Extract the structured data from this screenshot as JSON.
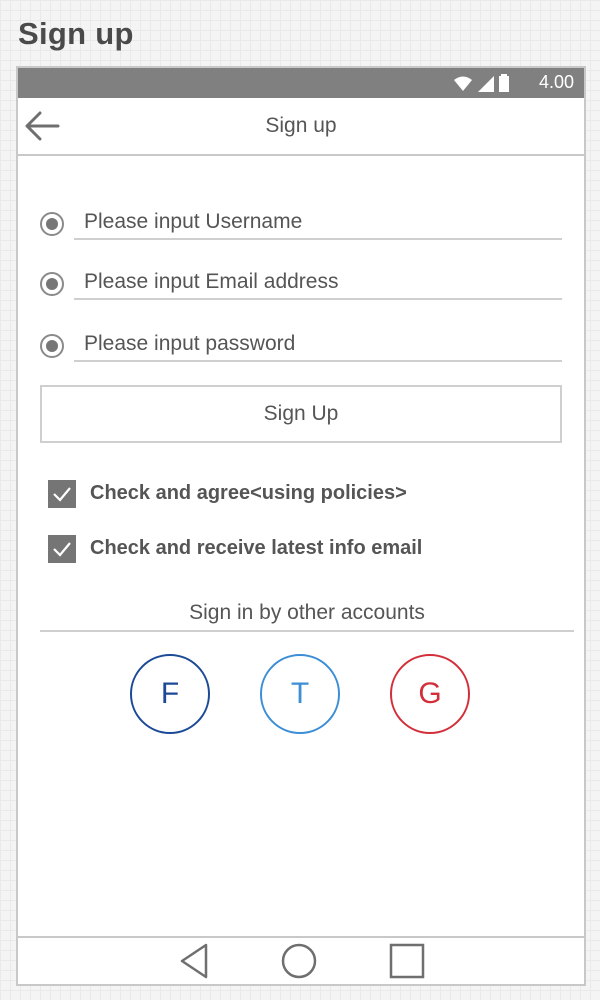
{
  "page": {
    "heading": "Sign up"
  },
  "status_bar": {
    "time": "4.00",
    "icons": [
      "wifi-icon",
      "signal-icon",
      "battery-icon"
    ]
  },
  "app_bar": {
    "title": "Sign up",
    "back_icon": "arrow-left-icon"
  },
  "form": {
    "username": {
      "placeholder": "Please input Username",
      "value": ""
    },
    "email": {
      "placeholder": "Please input Email address",
      "value": ""
    },
    "password": {
      "placeholder": "Please input password",
      "value": ""
    },
    "submit_label": "Sign Up"
  },
  "checkboxes": [
    {
      "label": "Check and agree<using policies>",
      "checked": true
    },
    {
      "label": "Check and receive latest info email",
      "checked": true
    }
  ],
  "other_accounts": {
    "title": "Sign in by other accounts",
    "providers": [
      {
        "letter": "F",
        "color": "#1c4a97"
      },
      {
        "letter": "T",
        "color": "#3c8ed6"
      },
      {
        "letter": "G",
        "color": "#d32f3a"
      }
    ]
  },
  "nav_bar": {
    "icons": [
      "back-triangle-icon",
      "home-circle-icon",
      "recents-square-icon"
    ]
  },
  "colors": {
    "status_bar": "#808080",
    "border": "#c8c8c8",
    "checkbox": "#757575"
  }
}
